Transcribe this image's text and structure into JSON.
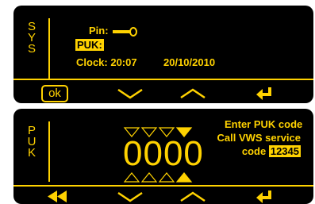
{
  "screen_sys": {
    "side_label": [
      "S",
      "Y",
      "S"
    ],
    "pin_label": "Pin:",
    "puk_label": "PUK:",
    "clock_label": "Clock: 20:07",
    "date_value": "20/10/2010",
    "softkeys": {
      "ok_label": "ok"
    }
  },
  "screen_puk": {
    "side_label": [
      "P",
      "U",
      "K"
    ],
    "digits": "0000",
    "message_line1": "Enter PUK code",
    "message_line2": "Call VWS service",
    "code_label": "code",
    "code_value": "12345"
  },
  "colors": {
    "accent": "#ffd200",
    "background": "#000000"
  },
  "icons": [
    "key-icon",
    "ok-button",
    "chevron-down-icon",
    "chevron-up-icon",
    "enter-icon",
    "double-back-icon"
  ]
}
